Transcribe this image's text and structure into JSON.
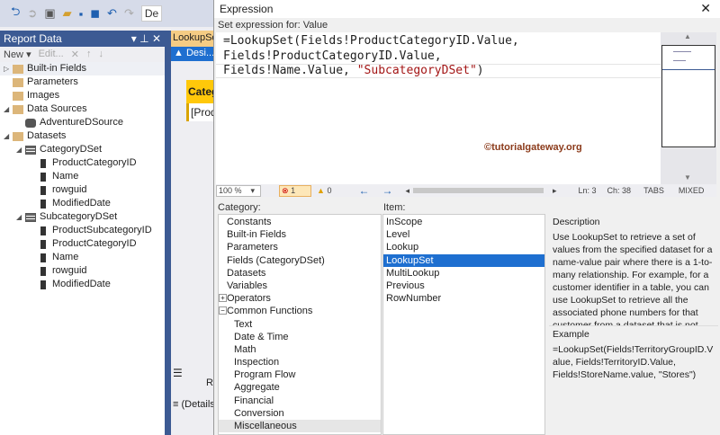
{
  "toolbar": {
    "icons": [
      "back-icon",
      "forward-icon",
      "new-item-icon",
      "open-icon",
      "save-icon",
      "save-all-icon",
      "undo-icon",
      "redo-icon"
    ],
    "config": "De"
  },
  "report_data": {
    "title": "Report Data",
    "new": "New",
    "edit": "Edit...",
    "tree": [
      {
        "label": "Built-in Fields",
        "type": "folder",
        "level": 0,
        "expander": "▷"
      },
      {
        "label": "Parameters",
        "type": "folder",
        "level": 0,
        "expander": ""
      },
      {
        "label": "Images",
        "type": "folder",
        "level": 0,
        "expander": ""
      },
      {
        "label": "Data Sources",
        "type": "folder",
        "level": 0,
        "expander": "◢"
      },
      {
        "label": "AdventureDSource",
        "type": "db",
        "level": 1,
        "expander": ""
      },
      {
        "label": "Datasets",
        "type": "folder",
        "level": 0,
        "expander": "◢"
      },
      {
        "label": "CategoryDSet",
        "type": "table",
        "level": 1,
        "expander": "◢"
      },
      {
        "label": "ProductCategoryID",
        "type": "field",
        "level": 2,
        "expander": ""
      },
      {
        "label": "Name",
        "type": "field",
        "level": 2,
        "expander": ""
      },
      {
        "label": "rowguid",
        "type": "field",
        "level": 2,
        "expander": ""
      },
      {
        "label": "ModifiedDate",
        "type": "field",
        "level": 2,
        "expander": ""
      },
      {
        "label": "SubcategoryDSet",
        "type": "table",
        "level": 1,
        "expander": "◢"
      },
      {
        "label": "ProductSubcategoryID",
        "type": "field",
        "level": 2,
        "expander": ""
      },
      {
        "label": "ProductCategoryID",
        "type": "field",
        "level": 2,
        "expander": ""
      },
      {
        "label": "Name",
        "type": "field",
        "level": 2,
        "expander": ""
      },
      {
        "label": "rowguid",
        "type": "field",
        "level": 2,
        "expander": ""
      },
      {
        "label": "ModifiedDate",
        "type": "field",
        "level": 2,
        "expander": ""
      }
    ]
  },
  "designer": {
    "tab": "LookupSet",
    "design": "Desi...",
    "header_cell": "Category",
    "data_cell": "[Prod",
    "group": "(Details)",
    "row_label": "R"
  },
  "dialog": {
    "title": "Expression",
    "set_for": "Set expression for: Value",
    "expression": {
      "l1": "=LookupSet(Fields!ProductCategoryID.Value,",
      "l2": "Fields!ProductCategoryID.Value,",
      "l3a": "Fields!Name.Value, ",
      "l3s": "\"SubcategoryDSet\"",
      "l3b": ")"
    },
    "watermark": "©tutorialgateway.org",
    "status": {
      "zoom": "100 %",
      "errors": "1",
      "warnings": "0",
      "ln": "Ln: 3",
      "ch": "Ch: 38",
      "tabs": "TABS",
      "mixed": "MIXED"
    },
    "category_label": "Category:",
    "item_label": "Item:",
    "categories": [
      {
        "label": "Constants",
        "indent": 0,
        "expander": ""
      },
      {
        "label": "Built-in Fields",
        "indent": 0,
        "expander": ""
      },
      {
        "label": "Parameters",
        "indent": 0,
        "expander": ""
      },
      {
        "label": "Fields (CategoryDSet)",
        "indent": 0,
        "expander": ""
      },
      {
        "label": "Datasets",
        "indent": 0,
        "expander": ""
      },
      {
        "label": "Variables",
        "indent": 0,
        "expander": ""
      },
      {
        "label": "Operators",
        "indent": 0,
        "expander": "+"
      },
      {
        "label": "Common Functions",
        "indent": 0,
        "expander": "−"
      },
      {
        "label": "Text",
        "indent": 1,
        "expander": ""
      },
      {
        "label": "Date & Time",
        "indent": 1,
        "expander": ""
      },
      {
        "label": "Math",
        "indent": 1,
        "expander": ""
      },
      {
        "label": "Inspection",
        "indent": 1,
        "expander": ""
      },
      {
        "label": "Program Flow",
        "indent": 1,
        "expander": ""
      },
      {
        "label": "Aggregate",
        "indent": 1,
        "expander": ""
      },
      {
        "label": "Financial",
        "indent": 1,
        "expander": ""
      },
      {
        "label": "Conversion",
        "indent": 1,
        "expander": ""
      },
      {
        "label": "Miscellaneous",
        "indent": 1,
        "expander": "",
        "selected": true
      }
    ],
    "items": [
      {
        "label": "InScope"
      },
      {
        "label": "Level"
      },
      {
        "label": "Lookup"
      },
      {
        "label": "LookupSet",
        "selected": true
      },
      {
        "label": "MultiLookup"
      },
      {
        "label": "Previous"
      },
      {
        "label": "RowNumber"
      }
    ],
    "description_label": "Description",
    "description": "Use LookupSet to retrieve a set of values from the specified dataset for a name-value pair where there is a 1-to-many relationship. For example, for a customer identifier in a table, you can use LookupSet to retrieve all the associated phone numbers for that customer from a dataset that is not",
    "example_label": "Example",
    "example": "=LookupSet(Fields!TerritoryGroupID.Value, Fields!TerritoryID.Value, Fields!StoreName.value, \"Stores\")"
  }
}
